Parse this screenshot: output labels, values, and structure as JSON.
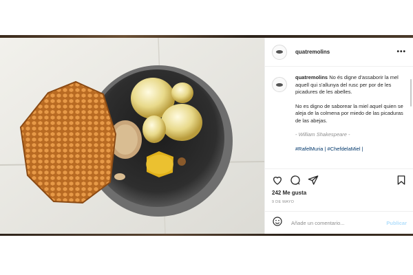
{
  "post": {
    "username": "quatremolins",
    "more_label": "•••",
    "caption": {
      "username": "quatremolins",
      "catalan": "No és digne d'assaborir la mel aquell qui s'allunya del rusc per por de les picadures de les abelles.",
      "spanish": "No es digno de saborear la miel aquel quien se aleja de la colmena por miedo de las picaduras de las abejas.",
      "quote_author": "- William Shakespeare -",
      "hashtags": "#RafelMuria | #ChefdelaMiel |"
    },
    "likes": "242 Me gusta",
    "date": "9 DE MAYO",
    "comment_placeholder": "Añade un comentario...",
    "publish_label": "Publicar"
  },
  "icons": {
    "like": "heart-icon",
    "comment": "comment-icon",
    "share": "paper-plane-icon",
    "save": "bookmark-icon",
    "emoji": "smiley-icon",
    "more": "more-dots-icon"
  },
  "colors": {
    "link": "#00376b",
    "publish_disabled": "#b2dffc",
    "muted": "#8e8e8e"
  }
}
